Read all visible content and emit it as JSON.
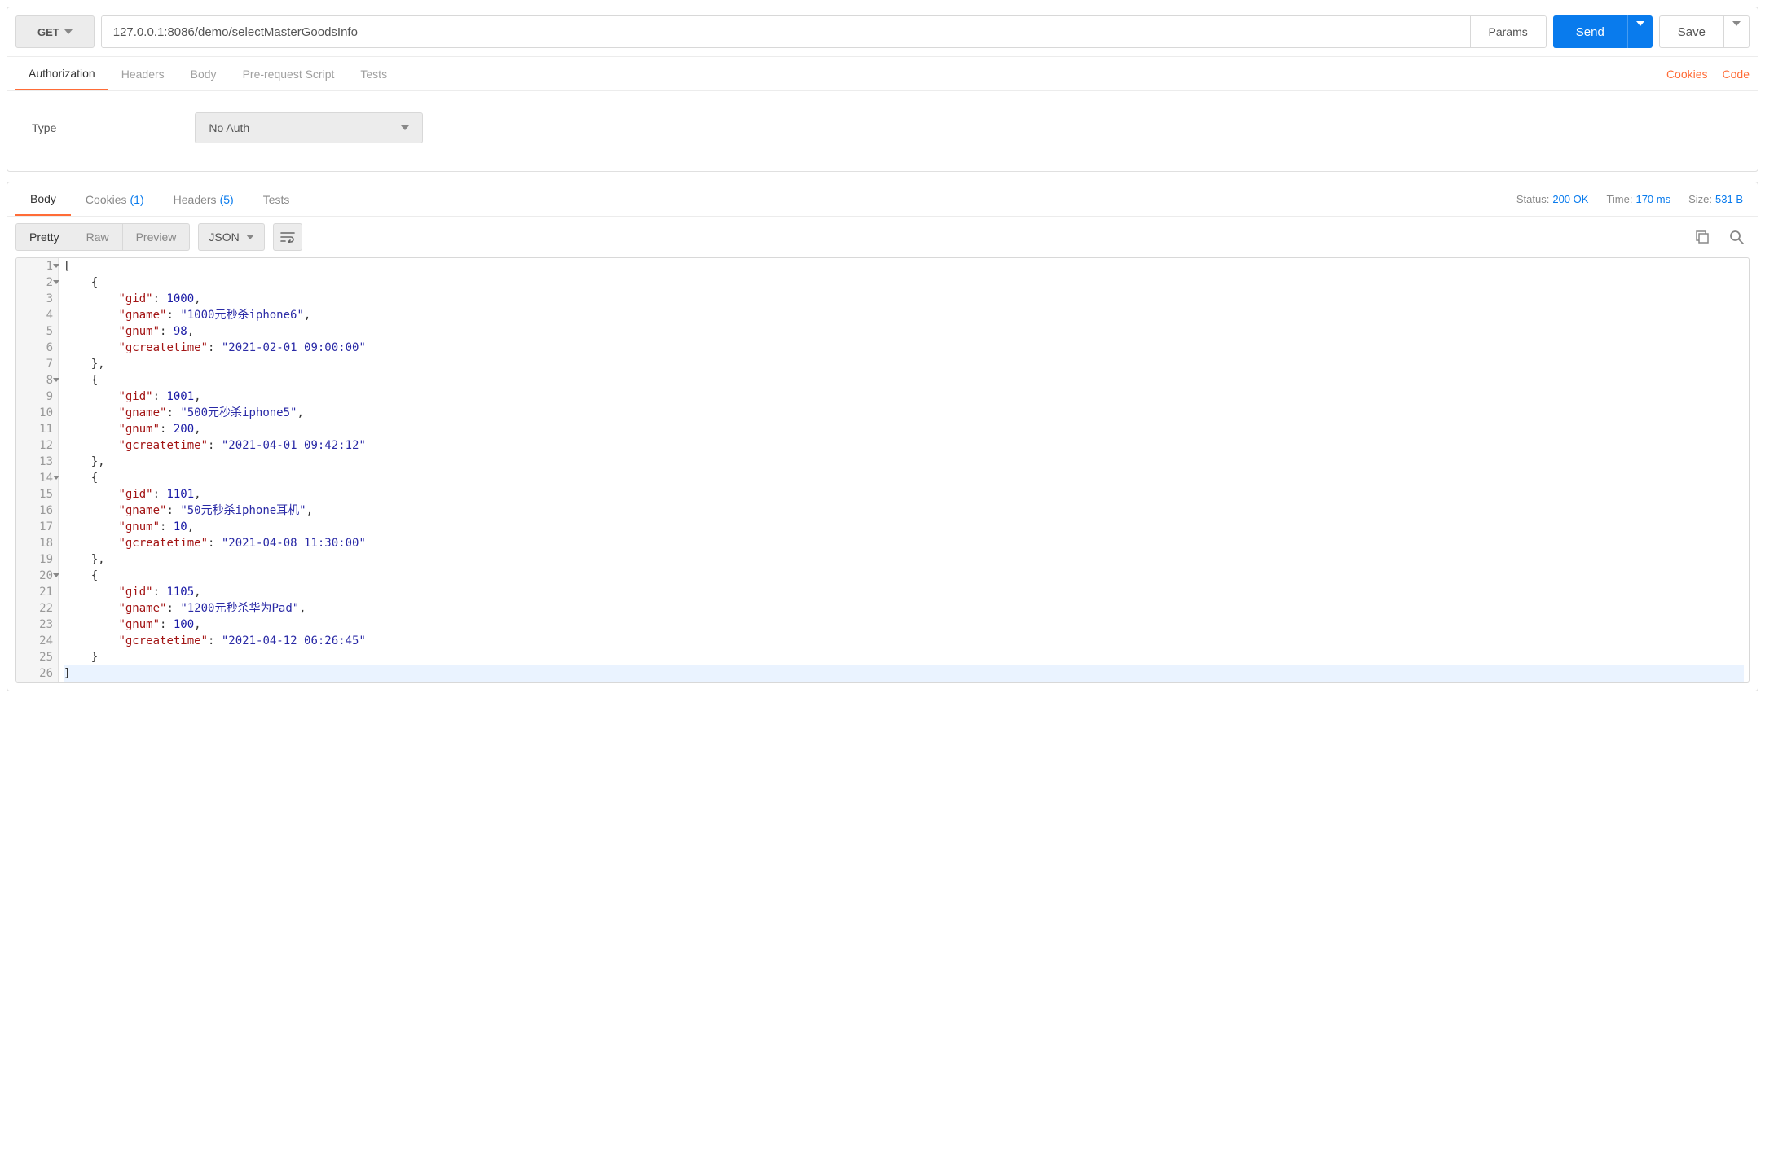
{
  "request": {
    "method": "GET",
    "url": "127.0.0.1:8086/demo/selectMasterGoodsInfo",
    "params_label": "Params",
    "send_label": "Send",
    "save_label": "Save"
  },
  "request_tabs": {
    "authorization": "Authorization",
    "headers": "Headers",
    "body": "Body",
    "pre_request": "Pre-request Script",
    "tests": "Tests",
    "cookies_link": "Cookies",
    "code_link": "Code"
  },
  "auth": {
    "type_label": "Type",
    "selected": "No Auth"
  },
  "response_tabs": {
    "body": "Body",
    "cookies": "Cookies",
    "cookies_count": "(1)",
    "headers": "Headers",
    "headers_count": "(5)",
    "tests": "Tests"
  },
  "status": {
    "status_label": "Status:",
    "status_value": "200 OK",
    "time_label": "Time:",
    "time_value": "170 ms",
    "size_label": "Size:",
    "size_value": "531 B"
  },
  "view": {
    "pretty": "Pretty",
    "raw": "Raw",
    "preview": "Preview",
    "format": "JSON"
  },
  "icons": {
    "wrap": "wrap-icon",
    "copy": "copy-icon",
    "search": "search-icon"
  },
  "gutter": {
    "count": 26,
    "fold_lines": [
      1,
      2,
      8,
      14,
      20
    ]
  },
  "json_body": [
    {
      "gid": 1000,
      "gname": "1000元秒杀iphone6",
      "gnum": 98,
      "gcreatetime": "2021-02-01 09:00:00"
    },
    {
      "gid": 1001,
      "gname": "500元秒杀iphone5",
      "gnum": 200,
      "gcreatetime": "2021-04-01 09:42:12"
    },
    {
      "gid": 1101,
      "gname": "50元秒杀iphone耳机",
      "gnum": 10,
      "gcreatetime": "2021-04-08 11:30:00"
    },
    {
      "gid": 1105,
      "gname": "1200元秒杀华为Pad",
      "gnum": 100,
      "gcreatetime": "2021-04-12 06:26:45"
    }
  ]
}
